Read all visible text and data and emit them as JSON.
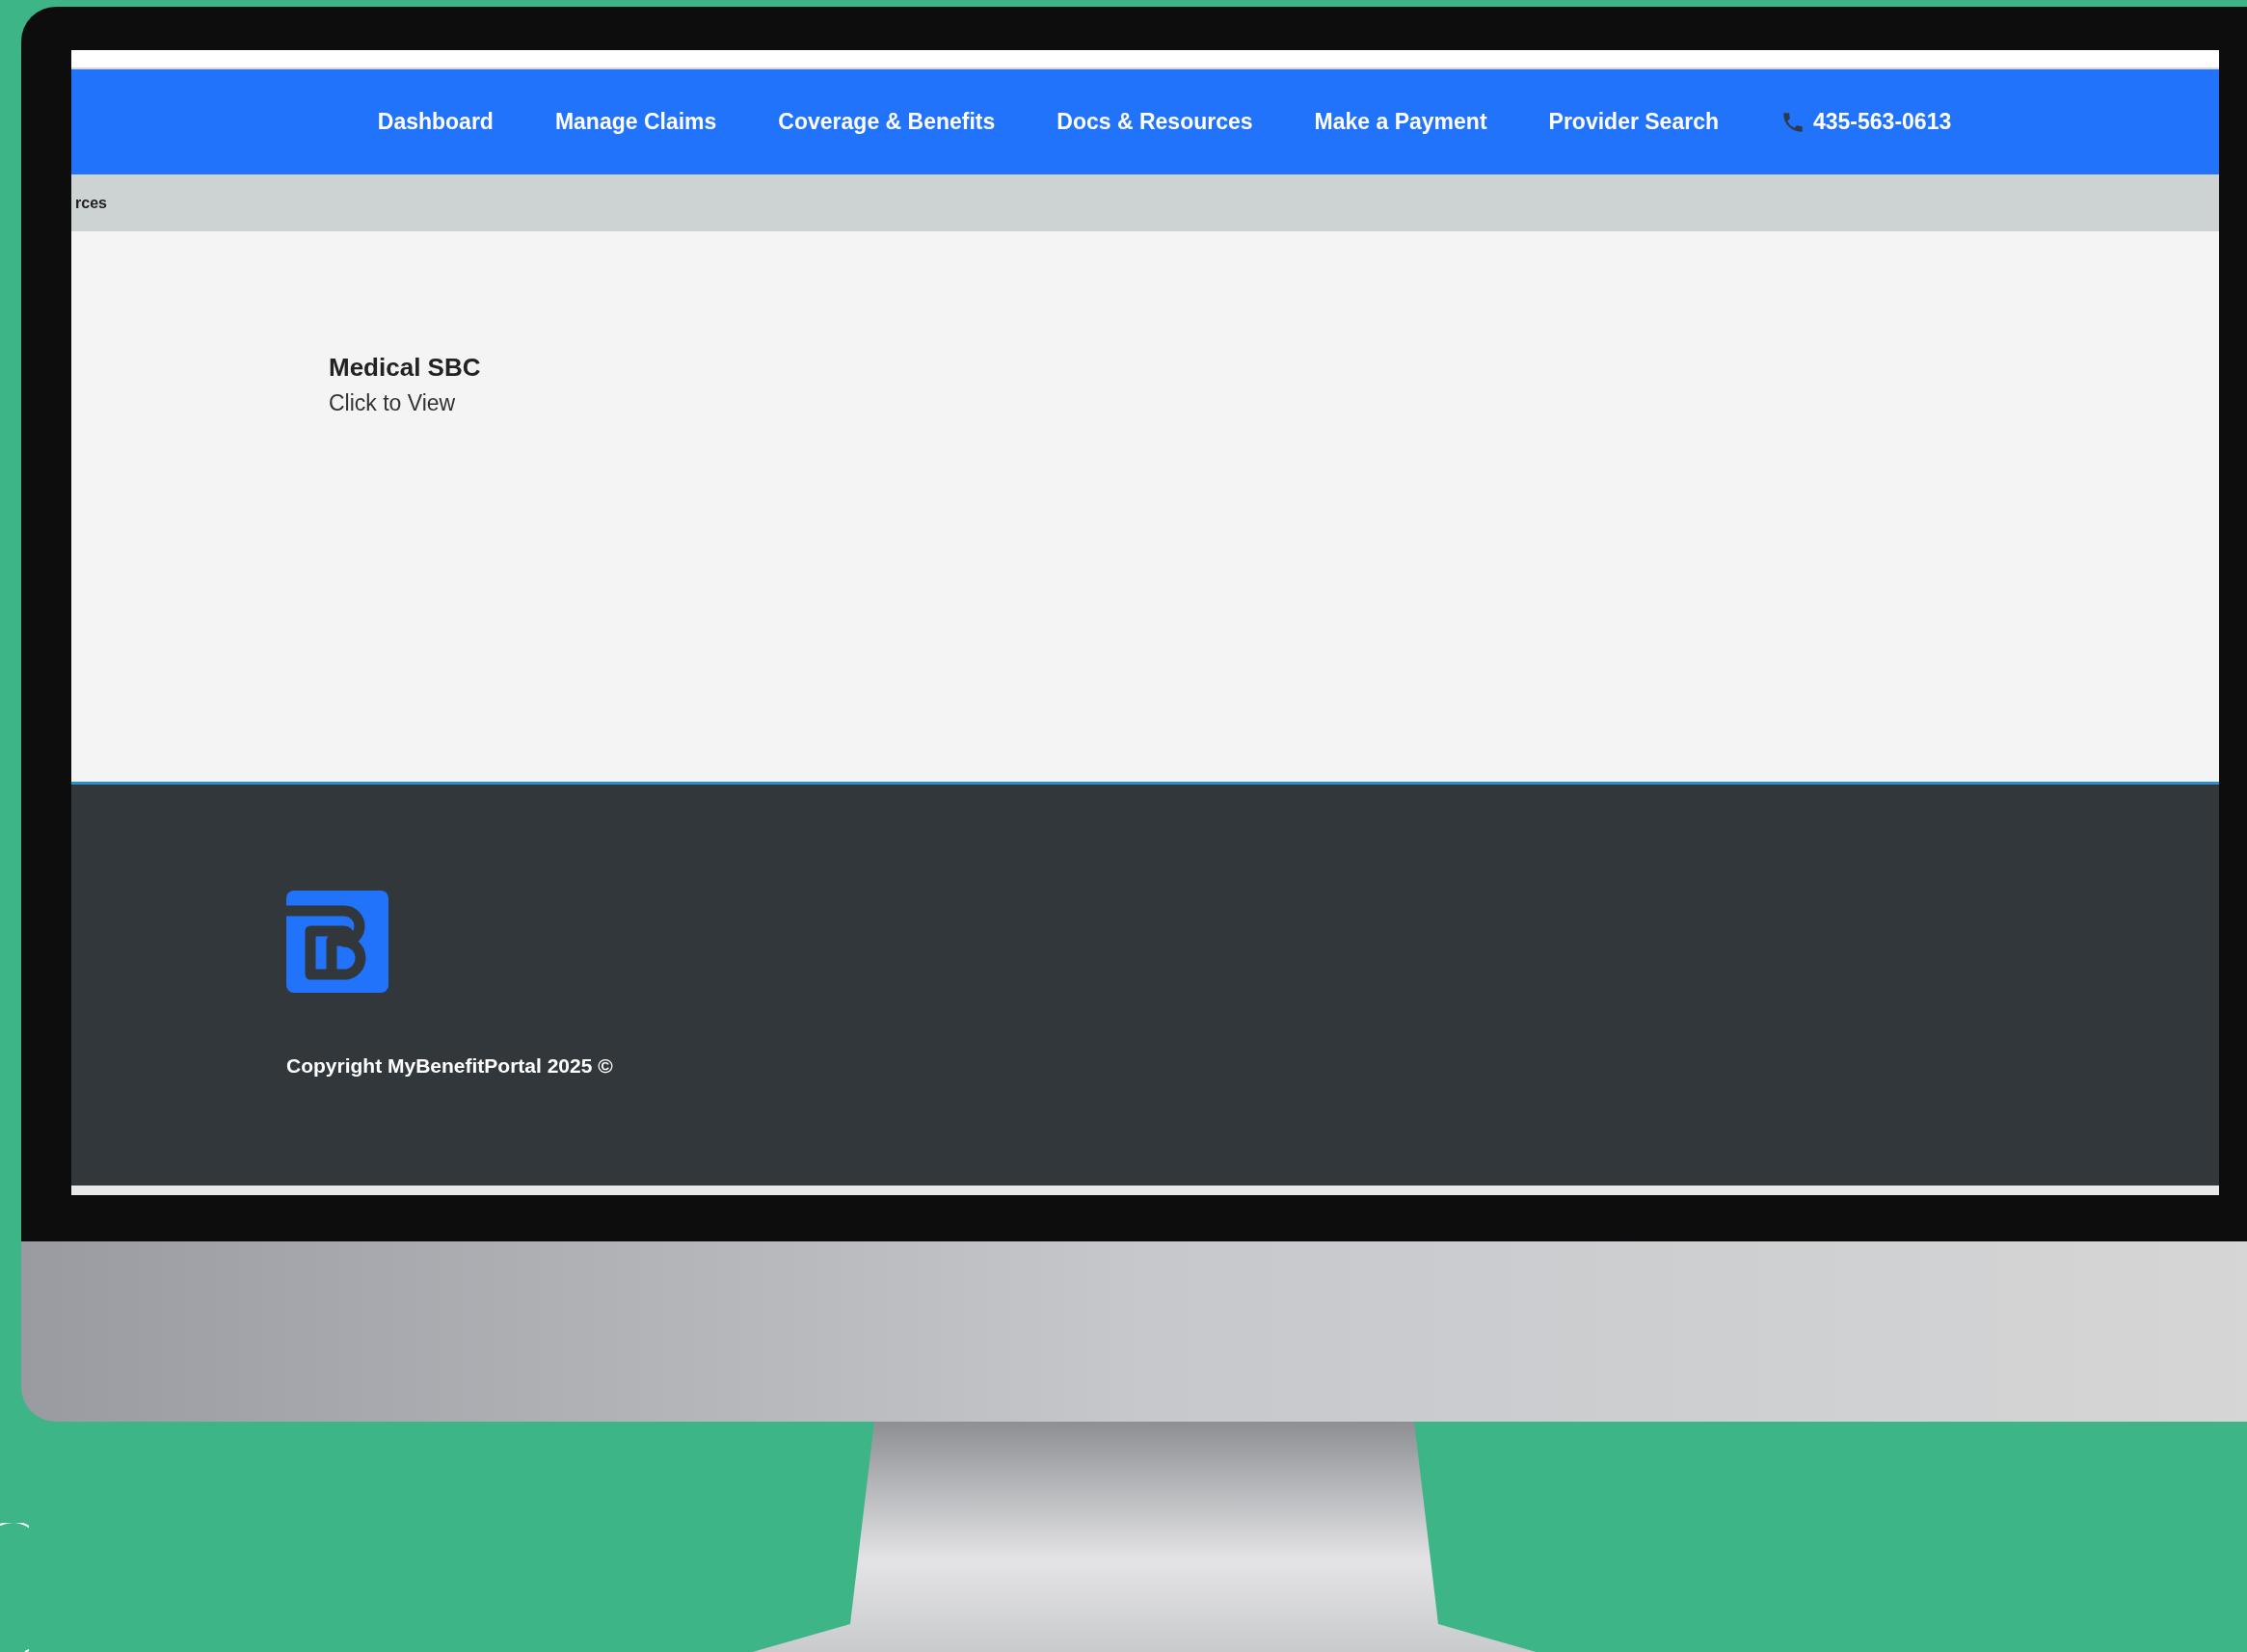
{
  "nav": {
    "items": [
      {
        "label": "Dashboard"
      },
      {
        "label": "Manage Claims"
      },
      {
        "label": "Coverage & Benefits"
      },
      {
        "label": "Docs & Resources"
      },
      {
        "label": "Make a Payment"
      },
      {
        "label": "Provider Search"
      }
    ],
    "phone": "435-563-0613"
  },
  "breadcrumb": "rces",
  "documents": [
    {
      "title": "Medical SBC",
      "link": "Click to View"
    }
  ],
  "footer": {
    "copyright": "Copyright MyBenefitPortal 2025 ©"
  }
}
